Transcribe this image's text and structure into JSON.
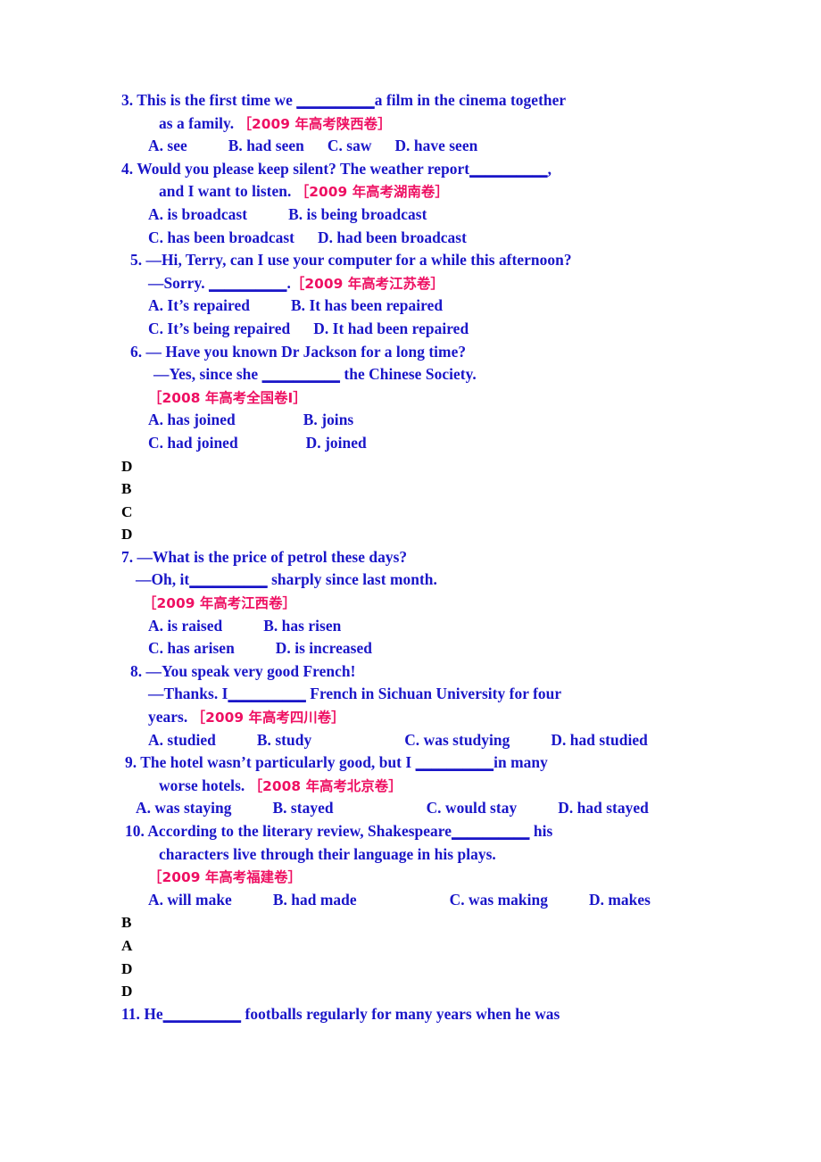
{
  "document": {
    "type": "english-grammar-exercise-worksheet",
    "text_color_question": "#1a16c8",
    "text_color_source": "#ee0f62",
    "text_color_answer": "#000000",
    "background": "#ffffff"
  },
  "lines": {
    "q3_l1_a": "3. This is the first time we ",
    "q3_l1_blank": "__________",
    "q3_l1_b": "a film in the cinema together",
    "q3_l2_a": "as a family.",
    "q3_l2_src": "［2009 年高考陕西卷］",
    "q3_optA": "A. see",
    "q3_optB": "B. had seen",
    "q3_optC": "C. saw",
    "q3_optD": "D. have seen",
    "q4_l1_a": "4. Would you please keep silent? The weather report",
    "q4_l1_blank": "__________",
    "q4_l1_b": ",",
    "q4_l2_a": "and I want to listen.",
    "q4_l2_src": "［2009 年高考湖南卷］",
    "q4_optA": "A. is broadcast",
    "q4_optB": "B. is being broadcast",
    "q4_optC": "C. has been broadcast",
    "q4_optD": "D. had been broadcast",
    "q5_l1": "5. —Hi, Terry, can I use your computer for a while this afternoon?",
    "q5_l2_a": "—Sorry. ",
    "q5_l2_blank": "__________",
    "q5_l2_b": ".",
    "q5_l2_src": "［2009 年高考江苏卷］",
    "q5_optA": "A. It’s repaired",
    "q5_optB": "B. It has been repaired",
    "q5_optC": "C. It’s being repaired",
    "q5_optD": "D. It had been repaired",
    "q6_l1": "6. — Have you known Dr Jackson for a long time?",
    "q6_l2_a": "—Yes, since she ",
    "q6_l2_blank": "__________",
    "q6_l2_b": " the Chinese Society.",
    "q6_l3_src": "［2008 年高考全国卷Ⅰ］",
    "q6_optA": "A. has joined",
    "q6_optB": "B. joins",
    "q6_optC": "C. had joined",
    "q6_optD": "D. joined",
    "answers_block1": [
      "D",
      "B",
      "C",
      "D"
    ],
    "q7_l1": "7. —What is the price of petrol these days?",
    "q7_l2_a": "—Oh, it",
    "q7_l2_blank": "__________",
    "q7_l2_b": " sharply since last month.",
    "q7_l3_src": "［2009 年高考江西卷］",
    "q7_optA": "A. is raised",
    "q7_optB": "B. has risen",
    "q7_optC": "C. has arisen",
    "q7_optD": "D. is increased",
    "q8_l1": "8. —You speak very good French!",
    "q8_l2_a": "—Thanks. I",
    "q8_l2_blank": "__________",
    "q8_l2_b": " French in Sichuan University for four",
    "q8_l3_a": "years.",
    "q8_l3_src": "［2009 年高考四川卷］",
    "q8_optA": "A. studied",
    "q8_optB": "B. study",
    "q8_optC": "C. was studying",
    "q8_optD": "D. had studied",
    "q9_l1_a": "9. The hotel wasn’t particularly good, but I ",
    "q9_l1_blank": "__________",
    "q9_l1_b": "in many",
    "q9_l2_a": "worse hotels.",
    "q9_l2_src": "［2008 年高考北京卷］",
    "q9_optA": "A. was staying",
    "q9_optB": "B. stayed",
    "q9_optC": "C. would stay",
    "q9_optD": "D. had stayed",
    "q10_l1_a": "10. According to the literary review, Shakespeare",
    "q10_l1_blank": "__________",
    "q10_l1_b": " his",
    "q10_l2": "characters live through their language in his plays.",
    "q10_l3_src": "［2009 年高考福建卷］",
    "q10_optA": "A. will make",
    "q10_optB": "B. had made",
    "q10_optC": "C. was making",
    "q10_optD": "D. makes",
    "answers_block2": [
      "B",
      "A",
      "D",
      "D"
    ],
    "q11_l1_a": "11. He",
    "q11_l1_blank": "__________",
    "q11_l1_b": " footballs regularly for many years when he was"
  }
}
